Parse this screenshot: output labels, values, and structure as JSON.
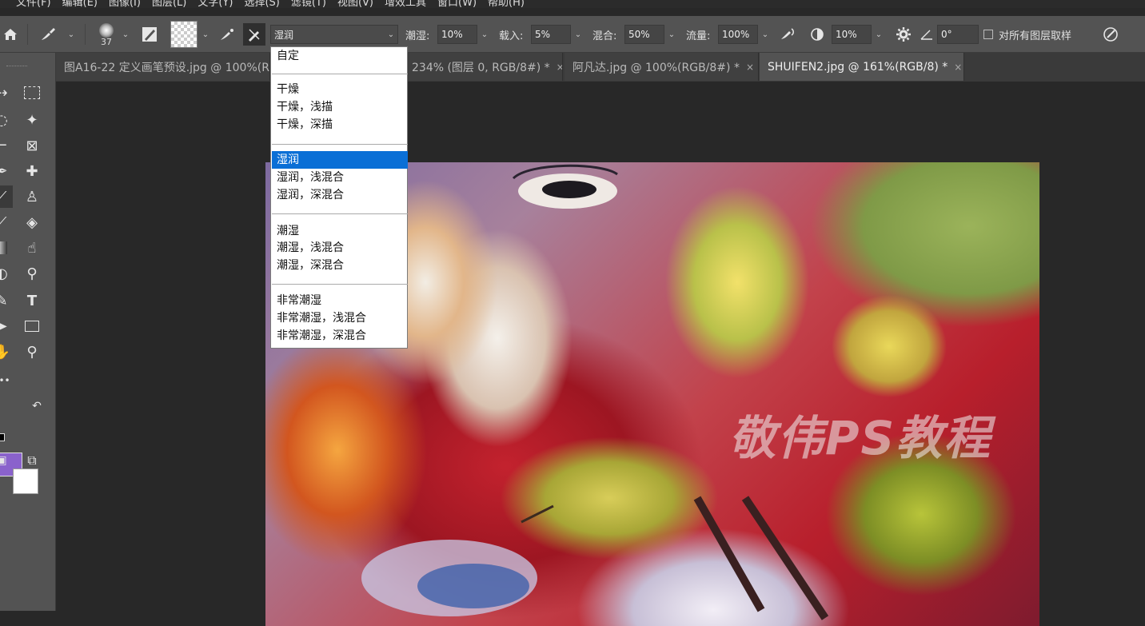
{
  "menu": [
    "文件(F)",
    "编辑(E)",
    "图像(I)",
    "图层(L)",
    "文字(Y)",
    "选择(S)",
    "滤镜(T)",
    "视图(V)",
    "增效工具",
    "窗口(W)",
    "帮助(H)"
  ],
  "options": {
    "brush_size": "37",
    "preset_value": "湿润",
    "wet_label": "潮湿:",
    "wet_value": "10%",
    "load_label": "载入:",
    "load_value": "5%",
    "mix_label": "混合:",
    "mix_value": "50%",
    "flow_label": "流量:",
    "flow_value": "100%",
    "smooth_value": "10%",
    "angle_value": "0°",
    "sample_all_label": "对所有图层取样"
  },
  "tabs": [
    {
      "label": "图A16-22 定义画笔预设.jpg @ 100%(R",
      "close": ""
    },
    {
      "label": "234% (图层 0, RGB/8#) *",
      "close": "×"
    },
    {
      "label": "阿凡达.jpg @ 100%(RGB/8#) *",
      "close": "×"
    },
    {
      "label": "SHUIFEN2.jpg @ 161%(RGB/8) *",
      "close": "×"
    }
  ],
  "dropdown": {
    "items": [
      "自定",
      "干燥",
      "干燥，浅描",
      "干燥，深描",
      "湿润",
      "湿润，浅混合",
      "湿润，深混合",
      "潮湿",
      "潮湿，浅混合",
      "潮湿，深混合",
      "非常潮湿",
      "非常潮湿，浅混合",
      "非常潮湿，深混合"
    ],
    "selected": "湿润"
  },
  "watermark": "敬伟PS教程",
  "colors": {
    "foreground": "#8a62cc",
    "background": "#ffffff",
    "selection": "#0a6fd6"
  },
  "icons": [
    "home-icon",
    "mixer-brush-icon",
    "brush-preview-icon",
    "clean-brush-icon",
    "load-brush-icon",
    "settings-gear-icon",
    "pressure-icon",
    "move-icon",
    "marquee-icon",
    "lasso-icon",
    "magic-wand-icon",
    "crop-icon",
    "frame-icon",
    "eyedropper-icon",
    "healing-icon",
    "brush-icon",
    "stamp-icon",
    "history-brush-icon",
    "eraser-icon",
    "gradient-icon",
    "smudge-icon",
    "dodge-icon",
    "pen-icon",
    "type-icon",
    "path-select-icon",
    "rectangle-icon",
    "hand-icon",
    "zoom-icon"
  ]
}
